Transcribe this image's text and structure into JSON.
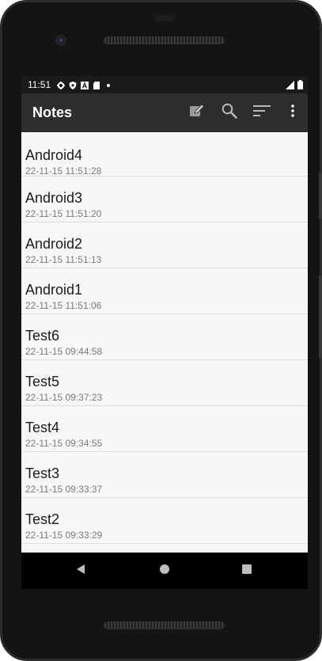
{
  "status_bar": {
    "time": "11:51",
    "icons": [
      "gear-icon",
      "shield-icon",
      "a-icon",
      "sd-card-icon",
      "dot-icon"
    ],
    "right_icons": [
      "signal-icon",
      "battery-icon"
    ]
  },
  "app_bar": {
    "title": "Notes",
    "actions": [
      "edit-icon",
      "search-icon",
      "sort-icon",
      "more-vert-icon"
    ]
  },
  "notes": [
    {
      "title": "Android4",
      "date": "22-11-15 11:51:28"
    },
    {
      "title": "Android3",
      "date": "22-11-15 11:51:20"
    },
    {
      "title": "Android2",
      "date": "22-11-15 11:51:13"
    },
    {
      "title": "Android1",
      "date": "22-11-15 11:51:06"
    },
    {
      "title": "Test6",
      "date": "22-11-15 09:44:58"
    },
    {
      "title": "Test5",
      "date": "22-11-15 09:37:23"
    },
    {
      "title": "Test4",
      "date": "22-11-15 09:34:55"
    },
    {
      "title": "Test3",
      "date": "22-11-15 09:33:37"
    },
    {
      "title": "Test2",
      "date": "22-11-15 09:33:29"
    },
    {
      "title": "",
      "date": ""
    }
  ],
  "nav_bar": [
    "back-icon",
    "home-icon",
    "recents-icon"
  ],
  "colors": {
    "app_bar": "#2e2e2e",
    "status_bar": "#1a1a1a",
    "list_background": "#f7f7f7",
    "divider": "#dcdcdc"
  }
}
